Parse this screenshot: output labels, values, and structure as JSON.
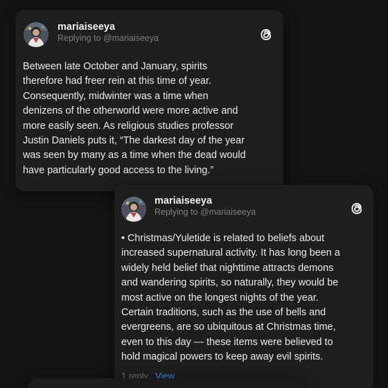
{
  "posts": [
    {
      "username": "mariaiseeya",
      "replying_to": "Replying to @mariaiseeya",
      "icon": "threads-icon",
      "body": "Between late October and January, spirits\ntherefore had freer rein at this time of year.\nConsequently, midwinter was a time when\ndenizens of the otherworld were more active and\nmore easily seen. As religious studies professor\nJustin Daniels puts it, “The darkest day of the year\nwas seen by many as a time when the dead would\nhave particularly good access to the living.”"
    },
    {
      "username": "mariaiseeya",
      "replying_to": "Replying to @mariaiseeya",
      "icon": "threads-icon",
      "body": "• Christmas/Yuletide is related to beliefs about\nincreased supernatural activity. It has long been a\nwidely held belief that nighttime attracts demons\nand wandering spirits, so naturally, they would be\nmost active on the longest nights of the year.\nCertain traditions, such as the use of bells and\nevergreens, are so ubiquitous at Christmas time,\neven to this day — these items were believed to\nhold magical powers to keep away evil spirits.",
      "reply_count": "1 reply",
      "view_label": "View"
    }
  ],
  "colors": {
    "background": "#141414",
    "card": "#1e1e1e",
    "text": "#ececec",
    "muted": "#7e7e7e",
    "link": "#3f8be0"
  }
}
